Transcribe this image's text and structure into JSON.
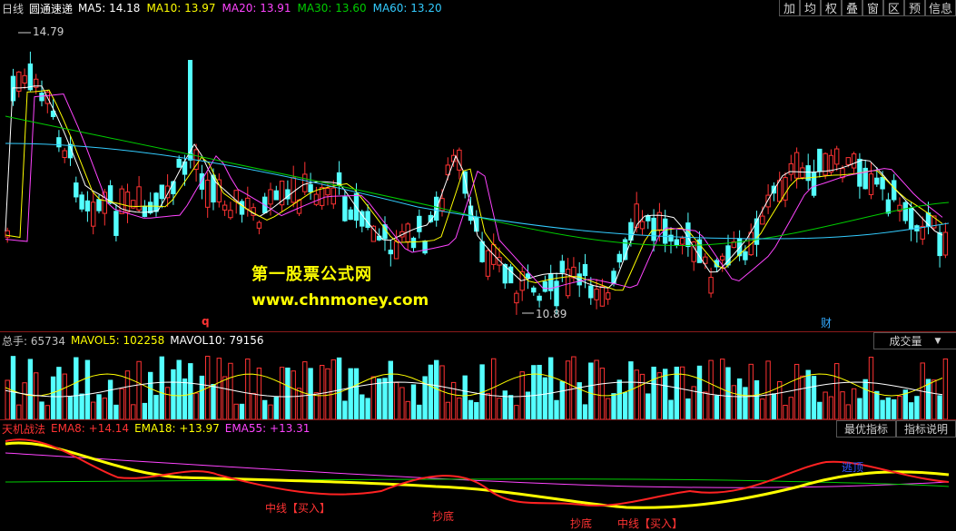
{
  "header": {
    "period": "日线",
    "stock_name": "圆通速递",
    "ma_items": [
      {
        "label": "MA5: 14.18",
        "color": "#ffffff"
      },
      {
        "label": "MA10: 13.97",
        "color": "#ffff00"
      },
      {
        "label": "MA20: 13.91",
        "color": "#ff44ff"
      },
      {
        "label": "MA30: 13.60",
        "color": "#00cc00"
      },
      {
        "label": "MA60: 13.20",
        "color": "#33ccff"
      }
    ],
    "buttons": [
      "加",
      "均",
      "权",
      "叠",
      "窗",
      "区",
      "预",
      "信息"
    ]
  },
  "price_chart": {
    "high_label": "14.79",
    "low_label": "10.89",
    "marker_q": "q",
    "marker_cai": "财",
    "watermark_title": "第一股票公式网",
    "watermark_url": "www.chnmoney.com",
    "up_color": "#ff3333",
    "down_color": "#54ffff"
  },
  "volume": {
    "label_total": "总手: 65734",
    "label_mavol5": "MAVOL5: 102258",
    "label_mavol10": "MAVOL10: 79156",
    "selector": "成交量"
  },
  "indicator": {
    "name": "天机战法",
    "ema8": "EMA8: +14.14",
    "ema18": "EMA18: +13.97",
    "ema55": "EMA55: +13.31",
    "btn_best": "最优指标",
    "btn_help": "指标说明",
    "annotations": {
      "buy_mid": "中线【买入】",
      "bottom1": "抄底",
      "bottom2": "抄底",
      "buy_mid2": "中线【买入】",
      "top": "逃顶"
    }
  }
}
